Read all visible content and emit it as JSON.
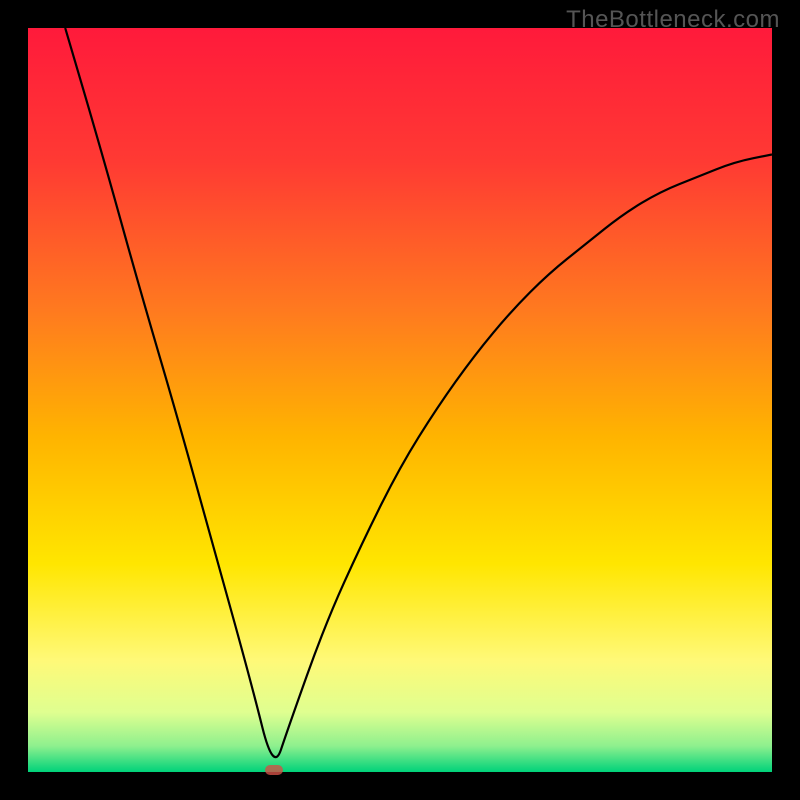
{
  "watermark": "TheBottleneck.com",
  "chart_data": {
    "type": "line",
    "title": "",
    "xlabel": "",
    "ylabel": "",
    "xlim": [
      0,
      100
    ],
    "ylim": [
      0,
      100
    ],
    "grid": false,
    "legend": false,
    "series": [
      {
        "name": "bottleneck-curve",
        "x": [
          5,
          10,
          15,
          20,
          25,
          30,
          33,
          35,
          40,
          45,
          50,
          55,
          60,
          65,
          70,
          75,
          80,
          85,
          90,
          95,
          100
        ],
        "y": [
          100,
          83,
          65,
          48,
          30,
          12,
          0,
          6,
          20,
          31,
          41,
          49,
          56,
          62,
          67,
          71,
          75,
          78,
          80,
          82,
          83
        ]
      }
    ],
    "minimum_marker": {
      "x": 33,
      "y": 0
    },
    "background_gradient_stops": [
      {
        "pos": 0.0,
        "color": "#ff1a3b"
      },
      {
        "pos": 0.18,
        "color": "#ff3a33"
      },
      {
        "pos": 0.38,
        "color": "#ff7a1f"
      },
      {
        "pos": 0.55,
        "color": "#ffb400"
      },
      {
        "pos": 0.72,
        "color": "#ffe600"
      },
      {
        "pos": 0.85,
        "color": "#fff978"
      },
      {
        "pos": 0.92,
        "color": "#dfff90"
      },
      {
        "pos": 0.965,
        "color": "#8ef08e"
      },
      {
        "pos": 1.0,
        "color": "#00d27a"
      }
    ]
  }
}
